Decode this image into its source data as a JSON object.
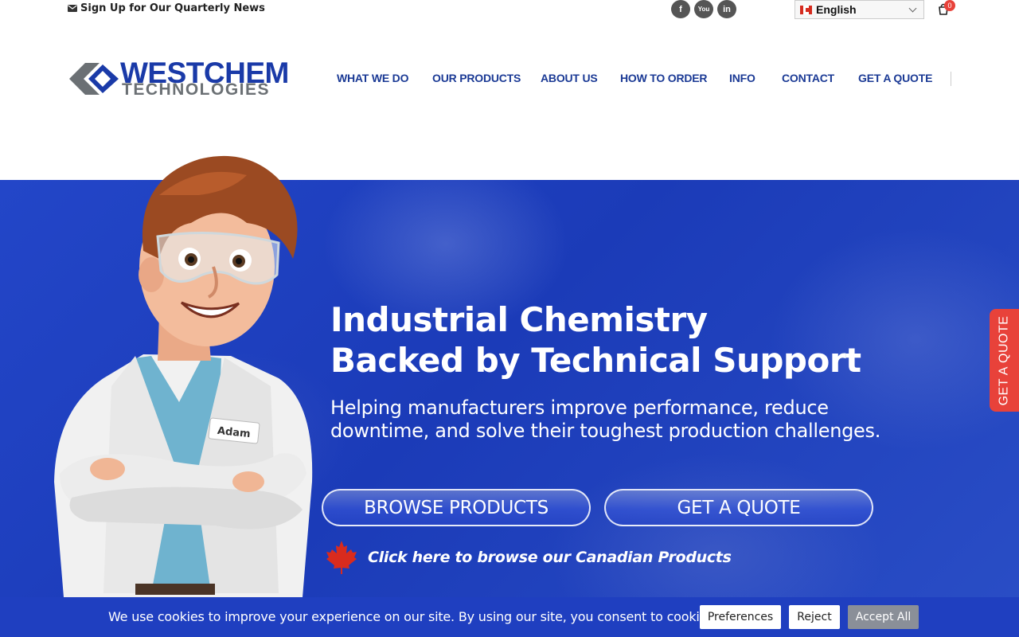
{
  "topbar": {
    "newsletter_label": "Sign Up for Our Quarterly News",
    "social": [
      {
        "icon": "facebook-icon",
        "glyph": "f"
      },
      {
        "icon": "youtube-icon",
        "glyph": "You"
      },
      {
        "icon": "linkedin-icon",
        "glyph": "in"
      }
    ],
    "language": "English",
    "cart_count": "0"
  },
  "header": {
    "logo_line1": "WESTCHEM",
    "logo_line2": "TECHNOLOGIES",
    "nav": [
      "WHAT WE DO",
      "OUR PRODUCTS",
      "ABOUT US",
      "HOW TO ORDER",
      "INFO",
      "CONTACT",
      "GET A QUOTE"
    ]
  },
  "hero": {
    "title_line1": "Industrial Chemistry",
    "title_line2": "Backed by Technical Support",
    "subtitle_line1": "Helping manufacturers improve performance, reduce",
    "subtitle_line2": "downtime, and solve their toughest production challenges.",
    "btn_browse": "BROWSE PRODUCTS",
    "btn_quote": "GET A QUOTE",
    "canada_link": "Click here to browse our Canadian Products",
    "badge_name": "Adam"
  },
  "side_tab": "GET A QUOTE",
  "cookie": {
    "text": "We use cookies to improve your experience on our site. By using our site, you consent to cookies.",
    "preferences": "Preferences",
    "reject": "Reject",
    "accept": "Accept All"
  },
  "colors": {
    "brand_blue": "#1b3a95",
    "hero_blue": "#2346c8",
    "accent_red": "#e8423a"
  }
}
